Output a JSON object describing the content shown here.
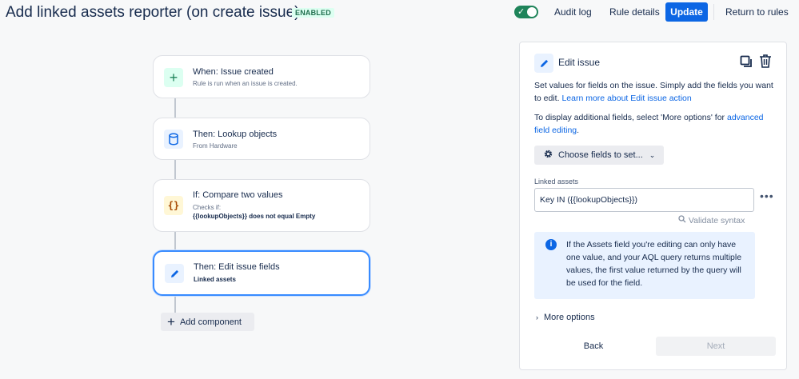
{
  "header": {
    "title": "Add linked assets reporter (on create issue)",
    "status_badge": "ENABLED",
    "toggle_enabled": true,
    "audit_log_label": "Audit log",
    "rule_details_label": "Rule details",
    "update_label": "Update",
    "return_label": "Return to rules"
  },
  "flow": {
    "cards": [
      {
        "title": "When: Issue created",
        "subtitle": "Rule is run when an issue is created.",
        "icon": "plus-icon",
        "icon_color": "#1f845a",
        "icon_bg": "#dcfff1"
      },
      {
        "title": "Then: Lookup objects",
        "subtitle": "From Hardware",
        "icon": "database-icon",
        "icon_color": "#0c66e4",
        "icon_bg": "#e9f2ff"
      },
      {
        "title": "If: Compare two values",
        "subtitle": "Checks if:",
        "detail": "{{lookupObjects}} does not equal Empty",
        "icon": "braces-icon",
        "icon_color": "#a54800",
        "icon_bg": "#fff7d6"
      },
      {
        "title": "Then: Edit issue fields",
        "detail": "Linked assets",
        "icon": "pencil-icon",
        "icon_color": "#0c66e4",
        "icon_bg": "#e9f2ff",
        "selected": true
      }
    ],
    "add_component_label": "Add component"
  },
  "panel": {
    "title": "Edit issue",
    "description": "Set values for fields on the issue. Simply add the fields you want to edit.",
    "learn_more_link": "Learn more about Edit issue action",
    "display_text": "To display additional fields, select 'More options' for",
    "advanced_link": "advanced field editing",
    "choose_fields_label": "Choose fields to set...",
    "field_label": "Linked assets",
    "field_value": "Key IN ({{lookupObjects}})",
    "validate_label": "Validate syntax",
    "info_text": "If the Assets field you're editing can only have one value, and your AQL query returns multiple values, the first value returned by the query will be used for the field.",
    "more_options_label": "More options",
    "back_label": "Back",
    "next_label": "Next"
  }
}
